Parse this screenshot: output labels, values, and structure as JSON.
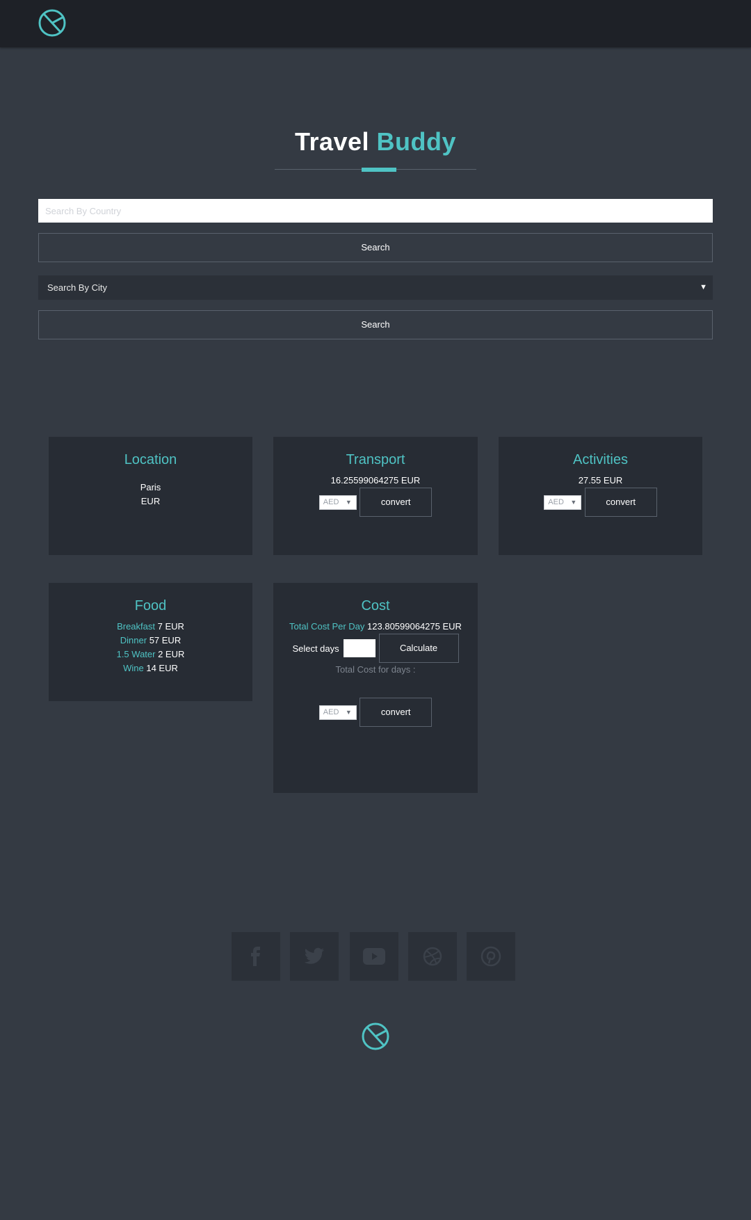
{
  "header": {
    "logo_icon": "circle-slash-logo-icon"
  },
  "hero": {
    "title_main": "Travel",
    "title_accent": "Buddy",
    "accent_color": "#4fc3c4"
  },
  "search": {
    "country_placeholder": "Search By Country",
    "country_value": "",
    "search_button_label": "Search",
    "city_select_value": "Search By City",
    "city_search_button_label": "Search"
  },
  "cards": {
    "location": {
      "title": "Location",
      "city": "Paris",
      "currency": "EUR"
    },
    "transport": {
      "title": "Transport",
      "amount": "16.25599064275 EUR",
      "currency_select": "AED",
      "convert_label": "convert"
    },
    "activities": {
      "title": "Activities",
      "amount": "27.55 EUR",
      "currency_select": "AED",
      "convert_label": "convert"
    },
    "food": {
      "title": "Food",
      "items": [
        {
          "name": "Breakfast",
          "value": "7 EUR"
        },
        {
          "name": "Dinner",
          "value": "57 EUR"
        },
        {
          "name": "1.5 Water",
          "value": "2 EUR"
        },
        {
          "name": "Wine",
          "value": "14 EUR"
        }
      ]
    },
    "cost": {
      "title": "Cost",
      "per_day_label": "Total Cost Per Day",
      "per_day_value": "123.80599064275",
      "per_day_currency": "EUR",
      "select_days_label": "Select days",
      "days_value": "",
      "calculate_label": "Calculate",
      "total_days_label": "Total Cost for days :",
      "currency_select": "AED",
      "convert_label": "convert"
    }
  },
  "footer": {
    "social": [
      "facebook-icon",
      "twitter-icon",
      "youtube-icon",
      "dribbble-icon",
      "pinterest-icon"
    ],
    "logo_icon": "circle-slash-logo-icon"
  }
}
